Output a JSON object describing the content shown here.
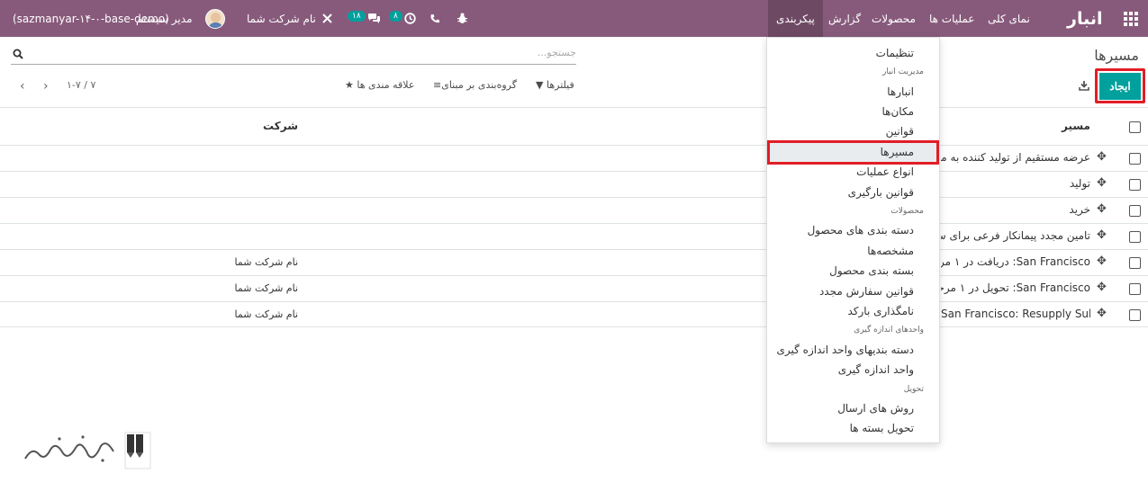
{
  "navbar": {
    "brand": "انبار",
    "menus": [
      "نمای کلی",
      "عملیات ها",
      "محصولات",
      "گزارش",
      "پیکربندی"
    ],
    "active_menu": "پیکربندی",
    "activity_badge": "۸",
    "messages_badge": "۱۸",
    "company": "نام شرکت شما",
    "user": "مدیر سیستم",
    "database": "(sazmanyar-۱۴-۰-base-demo)",
    "accent_color": "#875a7b"
  },
  "control_panel": {
    "breadcrumb": "مسیرها",
    "create_label": "ایجاد",
    "search_placeholder": "جستجو...",
    "filters_label": "فیلترها",
    "group_by_label": "گروه‌بندی بر مبنای",
    "favorites_label": "علاقه مندی ها",
    "pager": "۱-۷ / ۷"
  },
  "table": {
    "columns": [
      "مسیر",
      "شرکت"
    ],
    "rows": [
      {
        "route": "عرضه مستقیم از تولید کننده به مصرف کننده",
        "company": ""
      },
      {
        "route": "تولید",
        "company": ""
      },
      {
        "route": "خرید",
        "company": ""
      },
      {
        "route": "تامین مجدد پیمانکار فرعی برای سفارش",
        "company": ""
      },
      {
        "route": "San Francisco: دریافت در ۱ مرحله",
        "company": "نام شرکت شما"
      },
      {
        "route": "San Francisco: تحویل در ۱ مرحله",
        "company": "نام شرکت شما"
      },
      {
        "route": "San Francisco: Resupply Subcontractor",
        "company": "نام شرکت شما"
      }
    ]
  },
  "dropdown": {
    "items": [
      {
        "label": "تنظیمات",
        "type": "item"
      },
      {
        "label": "مدیریت انبار",
        "type": "header"
      },
      {
        "label": "انبارها",
        "type": "item"
      },
      {
        "label": "مکان‌ها",
        "type": "item"
      },
      {
        "label": "قوانین",
        "type": "item"
      },
      {
        "label": "مسیرها",
        "type": "item",
        "active": true
      },
      {
        "label": "انواع عملیات",
        "type": "item"
      },
      {
        "label": "قوانین بارگیری",
        "type": "item"
      },
      {
        "label": "محصولات",
        "type": "header"
      },
      {
        "label": "دسته بندی های محصول",
        "type": "item"
      },
      {
        "label": "مشخصه‌ها",
        "type": "item"
      },
      {
        "label": "بسته بندی محصول",
        "type": "item"
      },
      {
        "label": "قوانین سفارش مجدد",
        "type": "item"
      },
      {
        "label": "نامگذاری بارکد",
        "type": "item"
      },
      {
        "label": "واحدهای اندازه گیری",
        "type": "header"
      },
      {
        "label": "دسته بندیهای واحد اندازه گیری",
        "type": "item"
      },
      {
        "label": "واحد اندازه گیری",
        "type": "item"
      },
      {
        "label": "تحویل",
        "type": "header"
      },
      {
        "label": "روش های ارسال",
        "type": "item"
      },
      {
        "label": "تحویل بسته ها",
        "type": "item"
      }
    ]
  },
  "icons": {
    "apps": "grid-icon",
    "bug": "bug-icon",
    "phone": "phone-icon",
    "clock": "clock-icon",
    "chat": "chat-icon",
    "close": "close-icon",
    "search": "search-icon",
    "download": "download-icon",
    "move": "drag-handle-icon",
    "logo": "logo-icon"
  },
  "colors": {
    "primary": "#00a09d",
    "highlight": "#e11d26",
    "navbar": "#875a7b"
  }
}
